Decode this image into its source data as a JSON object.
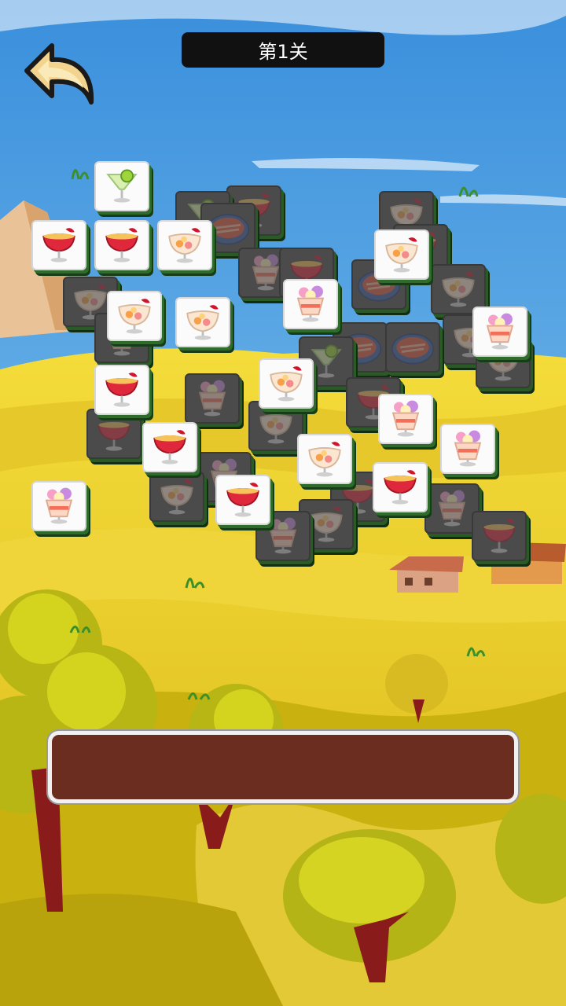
{
  "level": {
    "title": "第1关"
  },
  "icons": {
    "back": "back-arrow-icon"
  },
  "tile_types": [
    "margarita-cocktail",
    "red-cocktail",
    "fruit-sundae",
    "ice-cream-parfait",
    "sashimi-plate"
  ],
  "colors": {
    "sky": "#6ec0f0",
    "grass": "#e6cf24",
    "tile_face": "#fbfbfb",
    "tile_covered": "#4b4b4b",
    "tray": "#6b2d1f"
  },
  "board": {
    "tiles": [
      {
        "type": "sashimi-plate",
        "covered": true
      },
      {
        "type": "red-cocktail",
        "covered": true
      },
      {
        "type": "fruit-sundae",
        "covered": true
      },
      {
        "type": "margarita-cocktail",
        "covered": true
      },
      {
        "type": "sashimi-plate",
        "covered": true
      },
      {
        "type": "red-cocktail",
        "covered": true
      },
      {
        "type": "fruit-sundae",
        "covered": true
      },
      {
        "type": "ice-cream-parfait",
        "covered": true
      },
      {
        "type": "red-cocktail",
        "covered": true
      },
      {
        "type": "fruit-sundae",
        "covered": true
      },
      {
        "type": "sashimi-plate",
        "covered": true
      },
      {
        "type": "fruit-sundae",
        "covered": true
      },
      {
        "type": "sashimi-plate",
        "covered": true
      },
      {
        "type": "ice-cream-parfait",
        "covered": true
      },
      {
        "type": "margarita-cocktail",
        "covered": true
      },
      {
        "type": "fruit-sundae",
        "covered": true
      },
      {
        "type": "red-cocktail",
        "covered": true
      },
      {
        "type": "ice-cream-parfait",
        "covered": true
      },
      {
        "type": "fruit-sundae",
        "covered": true
      },
      {
        "type": "sashimi-plate",
        "covered": true
      },
      {
        "type": "red-cocktail",
        "covered": true
      },
      {
        "type": "ice-cream-parfait",
        "covered": true
      },
      {
        "type": "fruit-sundae",
        "covered": true
      },
      {
        "type": "red-cocktail",
        "covered": true
      },
      {
        "type": "ice-cream-parfait",
        "covered": true
      },
      {
        "type": "fruit-sundae",
        "covered": true
      },
      {
        "type": "red-cocktail",
        "covered": true
      },
      {
        "type": "ice-cream-parfait",
        "covered": true
      },
      {
        "type": "margarita-cocktail",
        "covered": false
      },
      {
        "type": "red-cocktail",
        "covered": false
      },
      {
        "type": "red-cocktail",
        "covered": false
      },
      {
        "type": "fruit-sundae",
        "covered": false
      },
      {
        "type": "fruit-sundae",
        "covered": false
      },
      {
        "type": "fruit-sundae",
        "covered": false
      },
      {
        "type": "fruit-sundae",
        "covered": false
      },
      {
        "type": "ice-cream-parfait",
        "covered": false
      },
      {
        "type": "ice-cream-parfait",
        "covered": false
      },
      {
        "type": "red-cocktail",
        "covered": false
      },
      {
        "type": "fruit-sundae",
        "covered": false
      },
      {
        "type": "ice-cream-parfait",
        "covered": false
      },
      {
        "type": "red-cocktail",
        "covered": false
      },
      {
        "type": "ice-cream-parfait",
        "covered": false
      },
      {
        "type": "fruit-sundae",
        "covered": false
      },
      {
        "type": "red-cocktail",
        "covered": false
      },
      {
        "type": "red-cocktail",
        "covered": false
      },
      {
        "type": "ice-cream-parfait",
        "covered": false
      }
    ]
  },
  "tray": {
    "slots": []
  }
}
